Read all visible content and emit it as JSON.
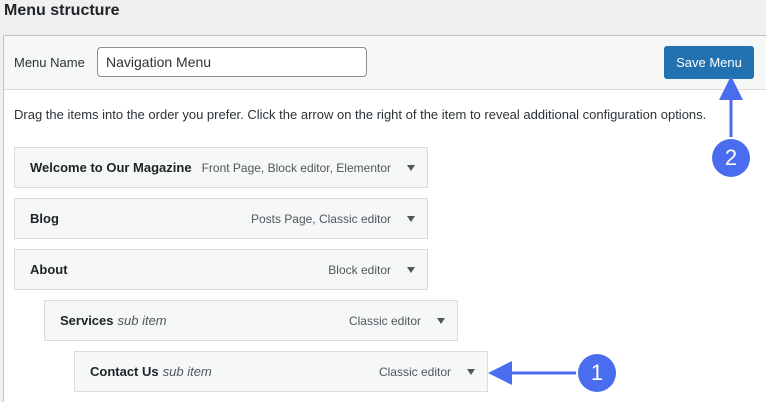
{
  "title": "Menu structure",
  "header": {
    "menu_name_label": "Menu Name",
    "menu_name_value": "Navigation Menu",
    "save_label": "Save Menu"
  },
  "instructions": "Drag the items into the order you prefer. Click the arrow on the right of the item to reveal additional configuration options.",
  "items": [
    {
      "title": "Welcome to Our Magazine",
      "sub": "",
      "type": "Front Page, Block editor, Elementor",
      "depth": 0
    },
    {
      "title": "Blog",
      "sub": "",
      "type": "Posts Page, Classic editor",
      "depth": 0
    },
    {
      "title": "About",
      "sub": "",
      "type": "Block editor",
      "depth": 0
    },
    {
      "title": "Services",
      "sub": "sub item",
      "type": "Classic editor",
      "depth": 1
    },
    {
      "title": "Contact Us",
      "sub": "sub item",
      "type": "Classic editor",
      "depth": 2
    }
  ],
  "annotations": [
    {
      "label": "1",
      "color": "#4a6df0"
    },
    {
      "label": "2",
      "color": "#4a6df0"
    }
  ],
  "colors": {
    "accent": "#2271b1",
    "annotation": "#4a6df0"
  }
}
